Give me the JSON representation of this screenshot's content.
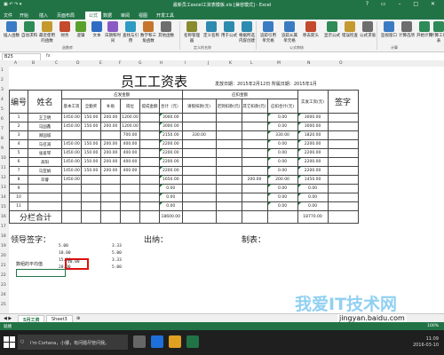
{
  "window": {
    "title": "最新员工excel工资表模板.xls [兼容模式] - Excel",
    "controls": "? ▭ – □ ✕"
  },
  "ribbon_tabs": [
    "文件",
    "开始",
    "插入",
    "页面布局",
    "公式",
    "数据",
    "审阅",
    "视图",
    "开发工具"
  ],
  "active_tab": "公式",
  "ribbon": {
    "buttons": [
      "插入函数",
      "自动求和",
      "最近使用的函数",
      "财务",
      "逻辑",
      "文本",
      "日期和时间",
      "查找与引用",
      "数学和三角函数",
      "其他函数",
      "名称管理器",
      "定义名称",
      "用于公式",
      "根据所选内容创建",
      "追踪引用单元格",
      "追踪从属单元格",
      "移去箭头",
      "显示公式",
      "错误检查",
      "公式求值",
      "监视窗口",
      "计算选项",
      "开始计算",
      "计算工作表"
    ],
    "groups": [
      "函数库",
      "定义的名称",
      "公式审核",
      "计算"
    ]
  },
  "formula_bar": {
    "name_box": "B25",
    "fx": "fx"
  },
  "columns": [
    "A",
    "B",
    "C",
    "D",
    "E",
    "F",
    "G",
    "H",
    "I",
    "J",
    "K",
    "L",
    "M",
    "N",
    "O"
  ],
  "rows": [
    "1",
    "2",
    "3",
    "4",
    "5",
    "6",
    "7",
    "8",
    "9",
    "10",
    "11",
    "12",
    "13",
    "14",
    "15",
    "16",
    "17",
    "18",
    "19",
    "20",
    "21",
    "22",
    "23",
    "24",
    "25"
  ],
  "sheet": {
    "title": "员工工资表",
    "date_info": "发放日期：2015年2月12日  所属日期：2015年1月",
    "headers": {
      "no": "编号",
      "name": "姓名",
      "should_pay": "应发金额",
      "deduct": "应扣金额",
      "sub_should": [
        "基本工资",
        "全勤奖",
        "补助",
        "岗位",
        "提成金额",
        "合计（元）"
      ],
      "sub_deduct": [
        "请假扣款(元)",
        "迟到扣款(元)",
        "其它扣款(元)",
        "应扣合计(元)"
      ],
      "actual": "实发工资(元)",
      "sign": "签字"
    },
    "rows": [
      {
        "no": "1",
        "name": "王卫明",
        "vals": [
          "1450.00",
          "150.00",
          "200.00",
          "1200.00",
          "",
          "3000.00",
          "",
          "",
          "",
          "0.00",
          "3000.00"
        ]
      },
      {
        "no": "2",
        "name": "马国鑫",
        "vals": [
          "1450.00",
          "150.00",
          "200.00",
          "1200.00",
          "",
          "3000.00",
          "",
          "",
          "",
          "0.00",
          "3000.00"
        ]
      },
      {
        "no": "3",
        "name": "郑国城",
        "vals": [
          "",
          "",
          "",
          "700.00",
          "",
          "2150.00",
          "330.00",
          "",
          "",
          "330.00",
          "1820.00"
        ]
      },
      {
        "no": "4",
        "name": "马召减",
        "vals": [
          "1450.00",
          "150.00",
          "200.00",
          "400.00",
          "",
          "2200.00",
          "",
          "",
          "",
          "0.00",
          "2200.00"
        ]
      },
      {
        "no": "5",
        "name": "张爱琴",
        "vals": [
          "1450.00",
          "150.00",
          "200.00",
          "400.00",
          "",
          "2200.00",
          "",
          "",
          "",
          "0.00",
          "2200.00"
        ]
      },
      {
        "no": "6",
        "name": "高阳",
        "vals": [
          "1450.00",
          "150.00",
          "200.00",
          "400.00",
          "",
          "2200.00",
          "",
          "",
          "",
          "0.00",
          "2200.00"
        ]
      },
      {
        "no": "7",
        "name": "马亚娟",
        "vals": [
          "1450.00",
          "150.00",
          "200.00",
          "400.00",
          "",
          "2200.00",
          "",
          "",
          "",
          "0.00",
          "2200.00"
        ]
      },
      {
        "no": "8",
        "name": "邓睿",
        "vals": [
          "1450.00",
          "",
          "",
          "",
          "",
          "1650.00",
          "",
          "",
          "200.00",
          "200.00",
          "1450.00"
        ]
      },
      {
        "no": "9",
        "name": "",
        "vals": [
          "",
          "",
          "",
          "",
          "",
          "0.00",
          "",
          "",
          "",
          "0.00",
          "0.00"
        ]
      },
      {
        "no": "10",
        "name": "",
        "vals": [
          "",
          "",
          "",
          "",
          "",
          "0.00",
          "",
          "",
          "",
          "0.00",
          "0.00"
        ]
      },
      {
        "no": "11",
        "name": "",
        "vals": [
          "",
          "",
          "",
          "",
          "",
          "0.00",
          "",
          "",
          "",
          "0.00",
          "0.00"
        ]
      }
    ],
    "total_label": "分栏合计",
    "total_should": "18600.00",
    "total_actual": "18770.00",
    "sign_labels": [
      "领导签字：",
      "出纳：",
      "制表："
    ],
    "calc_numbers": [
      "5.00",
      "10.00",
      "15.00",
      "20.00"
    ],
    "calc_right": [
      "3.33",
      "5.00",
      "3.33",
      "5.00"
    ],
    "average_label": "数组的平均值",
    "average_value": "10.00"
  },
  "sheet_tabs": [
    "5月工资",
    "Sheet3"
  ],
  "status": {
    "left": "就绪",
    "right": "100%"
  },
  "taskbar": {
    "search": "I'm Cortana，小娜，有问题尽管问我。",
    "time": "11:09",
    "date": "2016-03-10"
  },
  "watermark": {
    "text": "我爱IT技术网",
    "url": "jingyan.baidu.com"
  },
  "colors": {
    "accent": "#217346",
    "highlight": "#e01010"
  }
}
